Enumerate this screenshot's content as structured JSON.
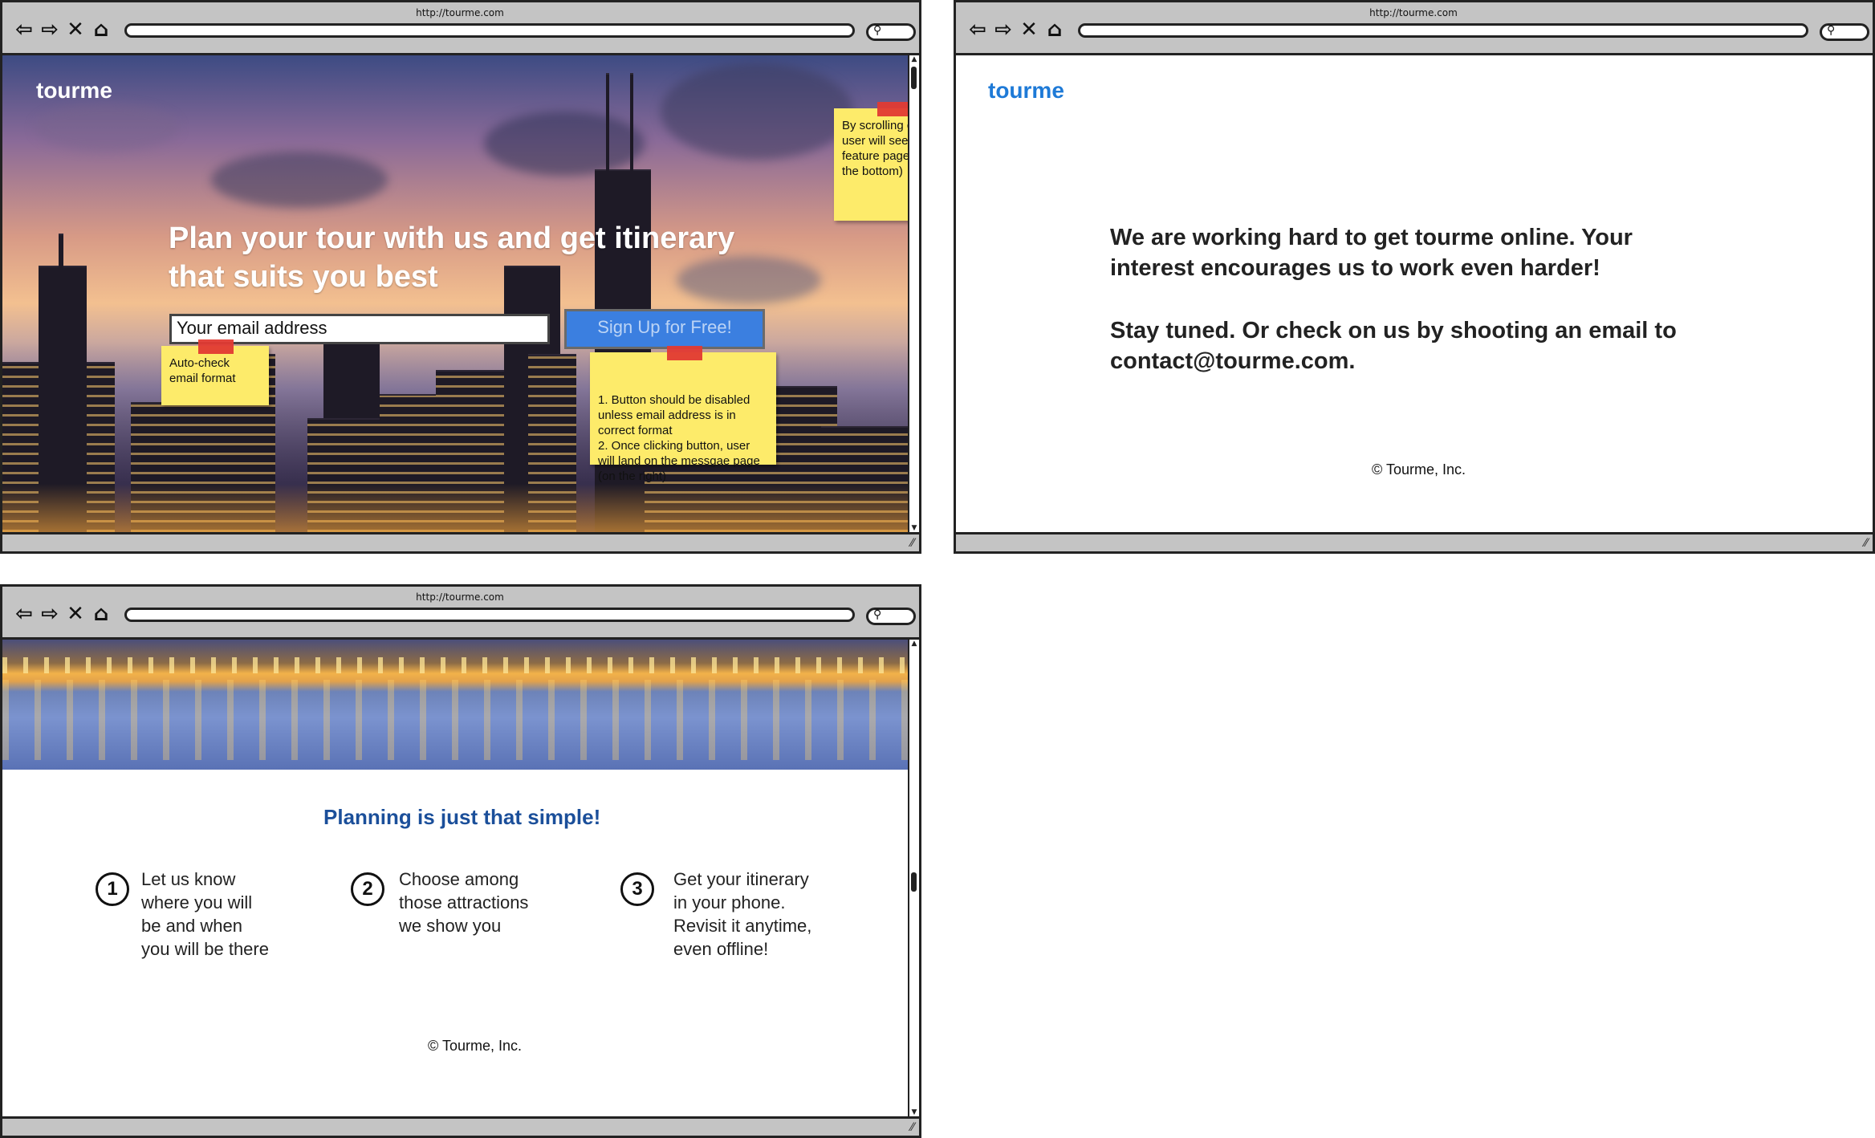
{
  "browser": {
    "url": "http://tourme.com",
    "nav_icons": [
      "back-icon",
      "forward-icon",
      "close-icon",
      "home-icon"
    ],
    "search_icon": "search-icon"
  },
  "landing": {
    "logo": "tourme",
    "headline_1": "Plan your tour with us and get itinerary",
    "headline_2": "that suits you best",
    "email_placeholder": "Your email address",
    "signup_label": "Sign Up for Free!",
    "notes": {
      "scroll": "By scrolling down, user will see the feature page (at the bottom)",
      "email": "Auto-check email format",
      "button": "1. Button should be disabled unless email address is in correct format\n2. Once clicking button, user will land on the messgae page (on the right)"
    }
  },
  "message_page": {
    "logo": "tourme",
    "line_1": "We are working hard to get tourme online. Your",
    "line_2": "interest encourages us to work even harder!",
    "line_3": "Stay tuned.  Or check on us by shooting an email to",
    "line_4": "contact@tourme.com.",
    "copyright": "© Tourme, Inc."
  },
  "feature_page": {
    "title": "Planning is just that simple!",
    "steps": [
      {
        "num": "1",
        "text": "Let us know\nwhere you will\nbe and when\nyou will be there"
      },
      {
        "num": "2",
        "text": "Choose among\nthose attractions\nwe show you"
      },
      {
        "num": "3",
        "text": "Get your itinerary\nin your phone.\nRevisit it anytime,\neven offline!"
      }
    ],
    "copyright": "© Tourme, Inc."
  },
  "colors": {
    "accent_blue": "#1e7ad7",
    "title_blue": "#1b4f9a",
    "button_blue": "#3b7fe0",
    "sticky_yellow": "#fdeb6a",
    "tape_red": "#e23a33"
  }
}
